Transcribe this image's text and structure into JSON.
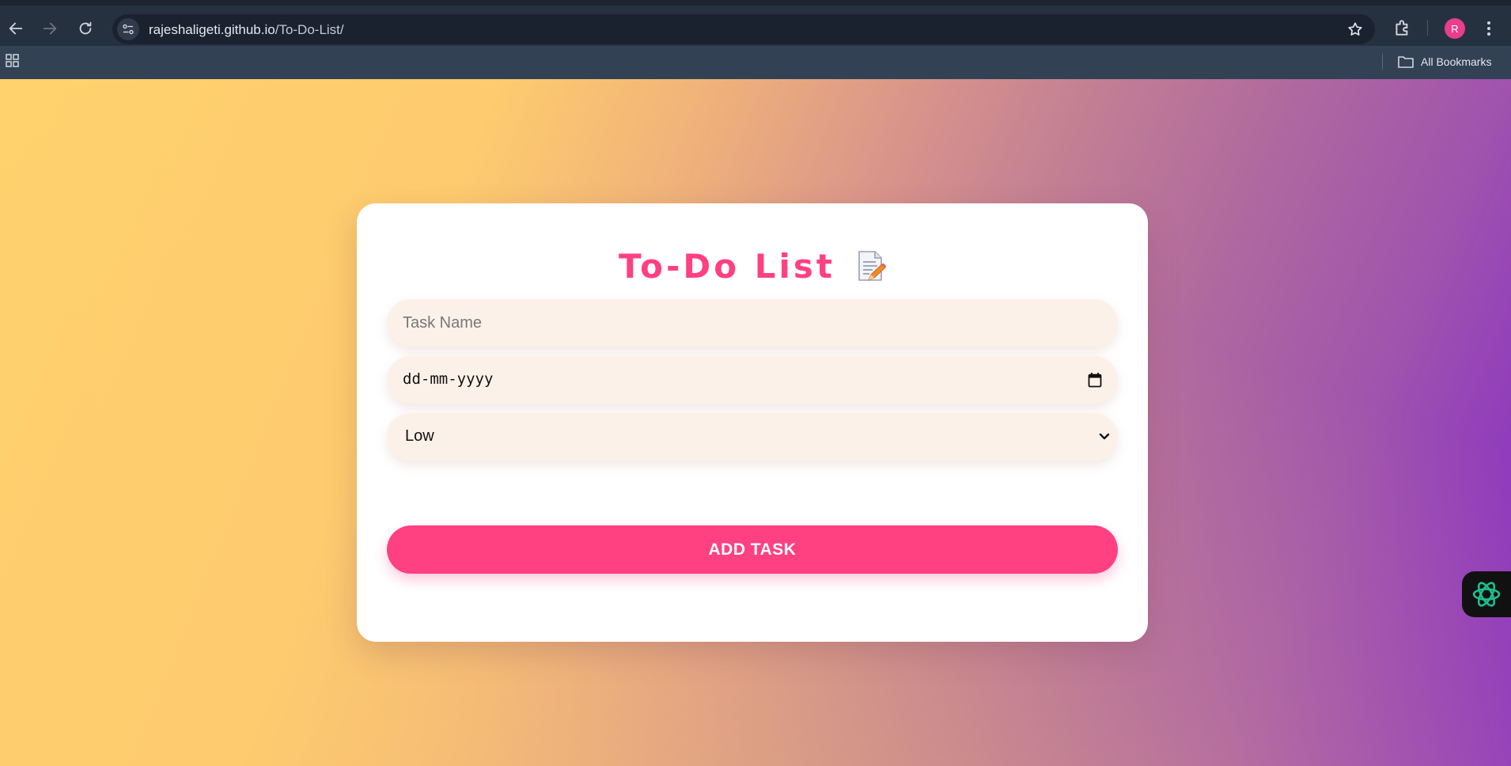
{
  "browser": {
    "url_host": "rajeshaligeti.github.io",
    "url_path": "/To-Do-List/",
    "profile_initial": "R",
    "bookmarks_label": "All Bookmarks"
  },
  "app": {
    "title": "To-Do List",
    "title_icon": "memo-icon",
    "task_name_placeholder": "Task Name",
    "date_placeholder": "dd-mm-yyyy",
    "priority_selected": "Low",
    "add_button_label": "ADD TASK"
  },
  "colors": {
    "accent": "#ff4081",
    "field_bg": "#fcf1e8",
    "gradient_start": "#ffd36e",
    "gradient_end": "#8228c8"
  }
}
